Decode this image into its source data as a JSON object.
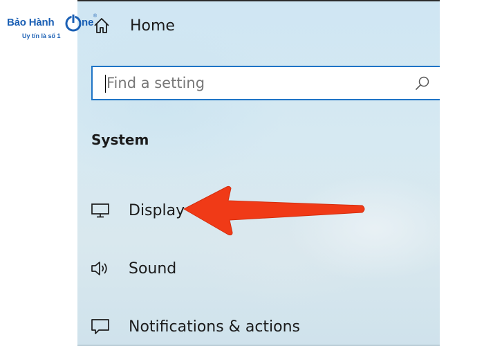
{
  "watermark": {
    "brand_prefix": "Bảo Hành ",
    "brand_suffix": "ne",
    "registered": "®",
    "tagline": "Uy tín là số 1",
    "color": "#1a5fb4"
  },
  "header": {
    "home_label": "Home",
    "home_icon": "home-icon"
  },
  "search": {
    "placeholder": "Find a setting",
    "value": "",
    "icon": "search-icon",
    "border_color": "#1f74c6"
  },
  "section": {
    "title": "System"
  },
  "nav": {
    "items": [
      {
        "label": "Display",
        "icon": "monitor-icon"
      },
      {
        "label": "Sound",
        "icon": "speaker-icon"
      },
      {
        "label": "Notifications & actions",
        "icon": "notification-icon"
      }
    ]
  },
  "annotation": {
    "color": "#f03a17",
    "points_to": "Display"
  }
}
